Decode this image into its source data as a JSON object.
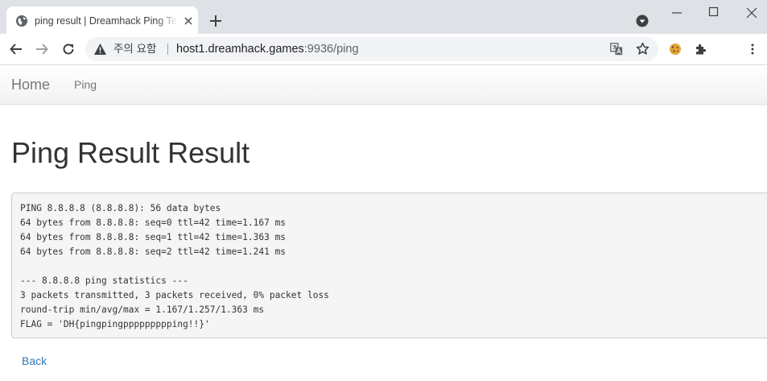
{
  "browser": {
    "tab_title": "ping result | Dreamhack Ping Tester",
    "security_label": "주의 요함",
    "url_host": "host1.dreamhack.games",
    "url_rest": ":9936/ping"
  },
  "icons": {
    "favicon": "globe-icon",
    "tab_close": "close-icon",
    "new_tab": "plus-icon",
    "tab_search": "dropdown-circle-icon",
    "back": "arrow-left-icon",
    "forward": "arrow-right-icon",
    "reload": "reload-icon",
    "security": "warning-triangle-icon",
    "translate": "translate-icon",
    "bookmark": "star-icon",
    "extension_cookie": "cookie-icon",
    "extensions": "puzzle-icon",
    "menu": "kebab-menu-icon"
  },
  "navbar": {
    "brand": "Home",
    "links": [
      "Ping"
    ]
  },
  "page": {
    "title": "Ping Result Result",
    "output_lines": [
      "PING 8.8.8.8 (8.8.8.8): 56 data bytes",
      "64 bytes from 8.8.8.8: seq=0 ttl=42 time=1.167 ms",
      "64 bytes from 8.8.8.8: seq=1 ttl=42 time=1.363 ms",
      "64 bytes from 8.8.8.8: seq=2 ttl=42 time=1.241 ms",
      "",
      "--- 8.8.8.8 ping statistics ---",
      "3 packets transmitted, 3 packets received, 0% packet loss",
      "round-trip min/avg/max = 1.167/1.257/1.363 ms",
      "FLAG = 'DH{pingpingppppppppping!!}'"
    ],
    "back_label": "Back"
  },
  "colors": {
    "tabstrip": "#dee1e6",
    "link": "#337ab7",
    "pre_background": "#f5f5f5",
    "title_text": "#333333"
  }
}
